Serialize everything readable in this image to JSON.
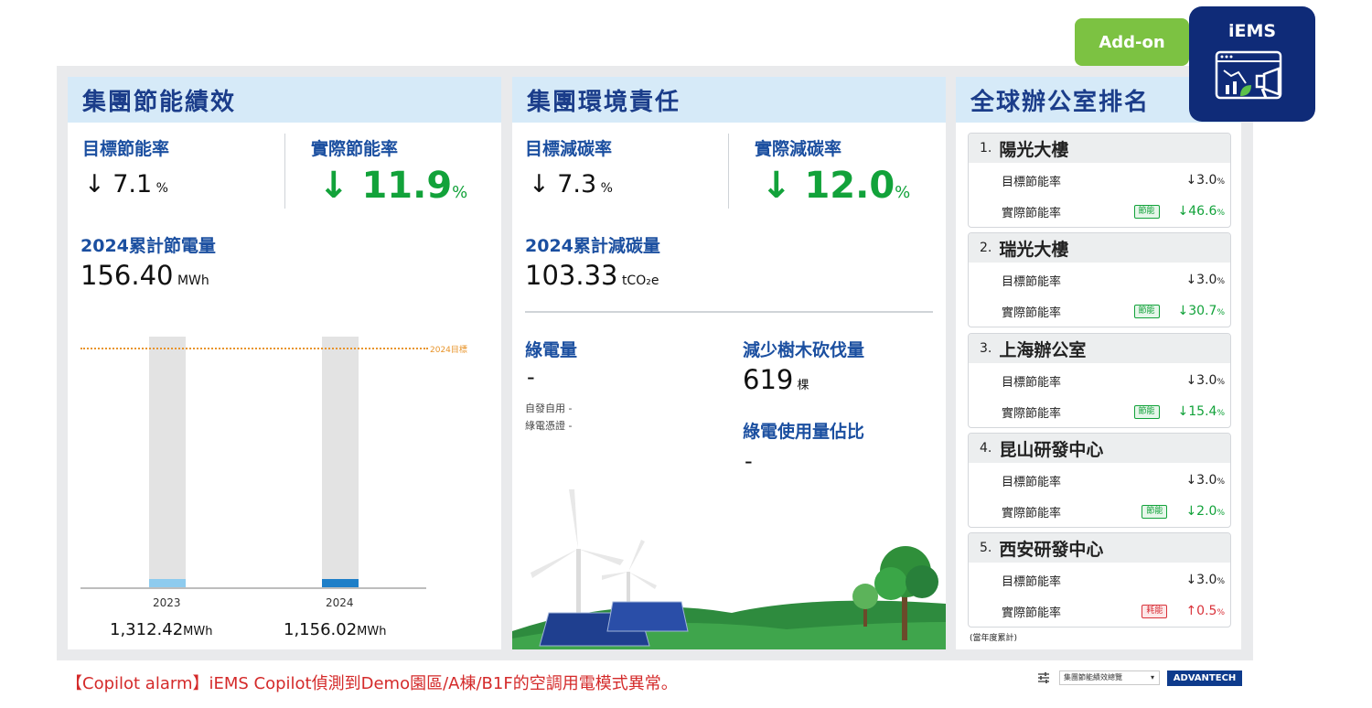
{
  "addon_label": "Add-on",
  "iems_label": "iEMS",
  "panel1": {
    "title": "集團節能績效",
    "target_label": "目標節能率",
    "target_arrow": "↓",
    "target_value": "7.1",
    "target_unit": "%",
    "actual_label": "實際節能率",
    "actual_arrow": "↓",
    "actual_value": "11.9",
    "actual_unit": "%",
    "cum_label": "2024累計節電量",
    "cum_value": "156.40",
    "cum_unit": "MWh",
    "target_line_label": "2024目標"
  },
  "chart_data": {
    "type": "bar",
    "categories": [
      "2023",
      "2024"
    ],
    "values": [
      1312.42,
      1156.02
    ],
    "value_labels": [
      "1,312.42",
      "1,156.02"
    ],
    "value_unit": "MWh",
    "target_label": "2024目標",
    "colors": [
      "#8ecbee",
      "#1e7fc8"
    ]
  },
  "panel2": {
    "title": "集團環境責任",
    "target_label": "目標減碳率",
    "target_arrow": "↓",
    "target_value": "7.3",
    "target_unit": "%",
    "actual_label": "實際減碳率",
    "actual_arrow": "↓",
    "actual_value": "12.0",
    "actual_unit": "%",
    "cum_label": "2024累計減碳量",
    "cum_value": "103.33",
    "cum_unit": "tCO₂e",
    "green_label": "綠電量",
    "green_value": "-",
    "self_use": "自發自用 -",
    "cert": "綠電憑證 -",
    "trees_label": "減少樹木砍伐量",
    "trees_value": "619",
    "trees_unit": "棵",
    "ratio_label": "綠電使用量佔比",
    "ratio_value": "-"
  },
  "panel3": {
    "title": "全球辦公室排名",
    "target_row_label": "目標節能率",
    "actual_row_label": "實際節能率",
    "offices": [
      {
        "rank": "1.",
        "name": "陽光大樓",
        "target": "↓3.0",
        "actual": "↓46.6",
        "tag": "節能",
        "status": "ok"
      },
      {
        "rank": "2.",
        "name": "瑞光大樓",
        "target": "↓3.0",
        "actual": "↓30.7",
        "tag": "節能",
        "status": "ok"
      },
      {
        "rank": "3.",
        "name": "上海辦公室",
        "target": "↓3.0",
        "actual": "↓15.4",
        "tag": "節能",
        "status": "ok"
      },
      {
        "rank": "4.",
        "name": "昆山研發中心",
        "target": "↓3.0",
        "actual": "↓2.0",
        "tag": "節能",
        "status": "ok"
      },
      {
        "rank": "5.",
        "name": "西安研發中心",
        "target": "↓3.0",
        "actual": "↑0.5",
        "tag": "耗能",
        "status": "bad"
      }
    ],
    "pct": "%",
    "footnote": "(當年度累計)"
  },
  "alarm_text": "【Copilot alarm】iEMS Copilot偵測到Demo園區/A棟/B1F的空調用電模式異常。",
  "footer": {
    "select_value": "集團節能績效總覽",
    "brand": "ADVANTECH"
  }
}
